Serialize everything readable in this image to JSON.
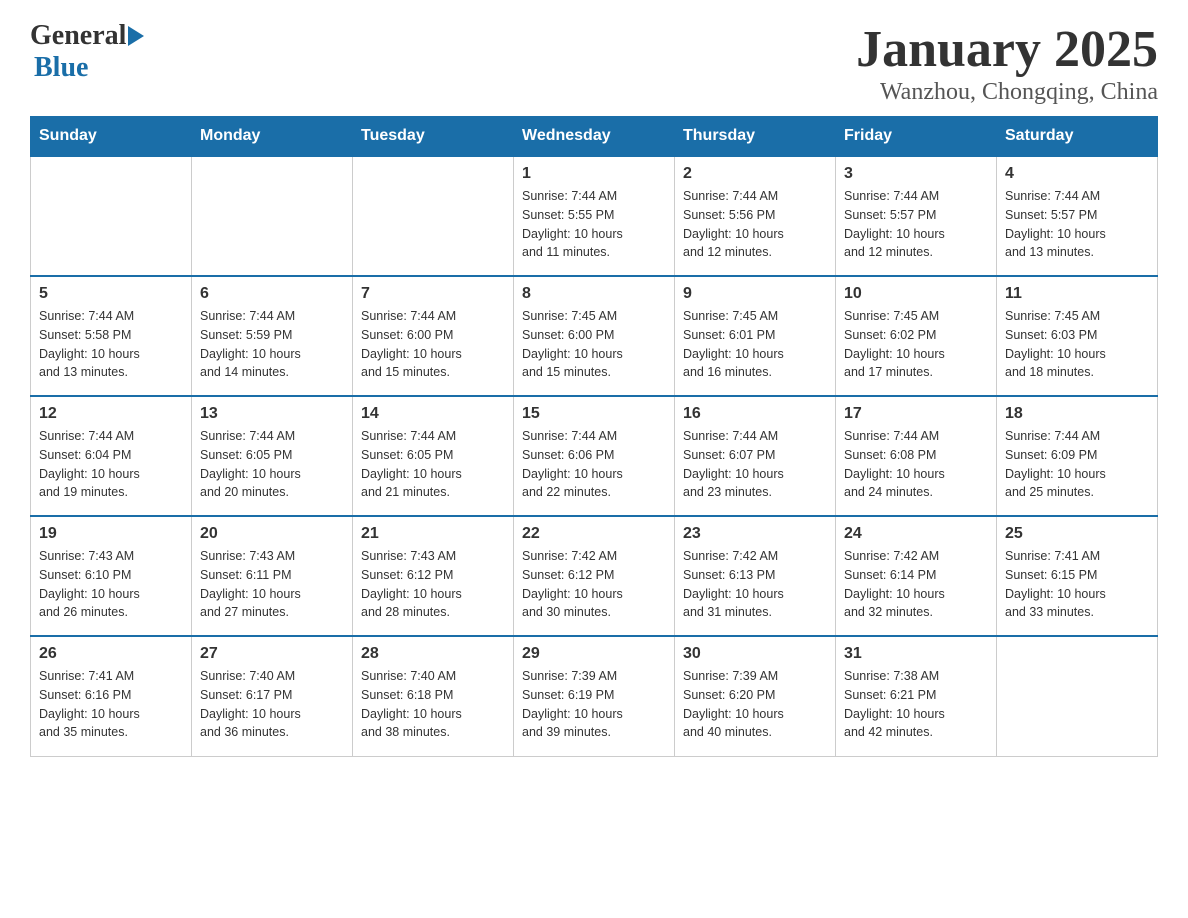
{
  "header": {
    "logo_general": "General",
    "logo_blue": "Blue",
    "main_title": "January 2025",
    "subtitle": "Wanzhou, Chongqing, China"
  },
  "days_of_week": [
    "Sunday",
    "Monday",
    "Tuesday",
    "Wednesday",
    "Thursday",
    "Friday",
    "Saturday"
  ],
  "weeks": [
    [
      {
        "day": "",
        "info": ""
      },
      {
        "day": "",
        "info": ""
      },
      {
        "day": "",
        "info": ""
      },
      {
        "day": "1",
        "info": "Sunrise: 7:44 AM\nSunset: 5:55 PM\nDaylight: 10 hours\nand 11 minutes."
      },
      {
        "day": "2",
        "info": "Sunrise: 7:44 AM\nSunset: 5:56 PM\nDaylight: 10 hours\nand 12 minutes."
      },
      {
        "day": "3",
        "info": "Sunrise: 7:44 AM\nSunset: 5:57 PM\nDaylight: 10 hours\nand 12 minutes."
      },
      {
        "day": "4",
        "info": "Sunrise: 7:44 AM\nSunset: 5:57 PM\nDaylight: 10 hours\nand 13 minutes."
      }
    ],
    [
      {
        "day": "5",
        "info": "Sunrise: 7:44 AM\nSunset: 5:58 PM\nDaylight: 10 hours\nand 13 minutes."
      },
      {
        "day": "6",
        "info": "Sunrise: 7:44 AM\nSunset: 5:59 PM\nDaylight: 10 hours\nand 14 minutes."
      },
      {
        "day": "7",
        "info": "Sunrise: 7:44 AM\nSunset: 6:00 PM\nDaylight: 10 hours\nand 15 minutes."
      },
      {
        "day": "8",
        "info": "Sunrise: 7:45 AM\nSunset: 6:00 PM\nDaylight: 10 hours\nand 15 minutes."
      },
      {
        "day": "9",
        "info": "Sunrise: 7:45 AM\nSunset: 6:01 PM\nDaylight: 10 hours\nand 16 minutes."
      },
      {
        "day": "10",
        "info": "Sunrise: 7:45 AM\nSunset: 6:02 PM\nDaylight: 10 hours\nand 17 minutes."
      },
      {
        "day": "11",
        "info": "Sunrise: 7:45 AM\nSunset: 6:03 PM\nDaylight: 10 hours\nand 18 minutes."
      }
    ],
    [
      {
        "day": "12",
        "info": "Sunrise: 7:44 AM\nSunset: 6:04 PM\nDaylight: 10 hours\nand 19 minutes."
      },
      {
        "day": "13",
        "info": "Sunrise: 7:44 AM\nSunset: 6:05 PM\nDaylight: 10 hours\nand 20 minutes."
      },
      {
        "day": "14",
        "info": "Sunrise: 7:44 AM\nSunset: 6:05 PM\nDaylight: 10 hours\nand 21 minutes."
      },
      {
        "day": "15",
        "info": "Sunrise: 7:44 AM\nSunset: 6:06 PM\nDaylight: 10 hours\nand 22 minutes."
      },
      {
        "day": "16",
        "info": "Sunrise: 7:44 AM\nSunset: 6:07 PM\nDaylight: 10 hours\nand 23 minutes."
      },
      {
        "day": "17",
        "info": "Sunrise: 7:44 AM\nSunset: 6:08 PM\nDaylight: 10 hours\nand 24 minutes."
      },
      {
        "day": "18",
        "info": "Sunrise: 7:44 AM\nSunset: 6:09 PM\nDaylight: 10 hours\nand 25 minutes."
      }
    ],
    [
      {
        "day": "19",
        "info": "Sunrise: 7:43 AM\nSunset: 6:10 PM\nDaylight: 10 hours\nand 26 minutes."
      },
      {
        "day": "20",
        "info": "Sunrise: 7:43 AM\nSunset: 6:11 PM\nDaylight: 10 hours\nand 27 minutes."
      },
      {
        "day": "21",
        "info": "Sunrise: 7:43 AM\nSunset: 6:12 PM\nDaylight: 10 hours\nand 28 minutes."
      },
      {
        "day": "22",
        "info": "Sunrise: 7:42 AM\nSunset: 6:12 PM\nDaylight: 10 hours\nand 30 minutes."
      },
      {
        "day": "23",
        "info": "Sunrise: 7:42 AM\nSunset: 6:13 PM\nDaylight: 10 hours\nand 31 minutes."
      },
      {
        "day": "24",
        "info": "Sunrise: 7:42 AM\nSunset: 6:14 PM\nDaylight: 10 hours\nand 32 minutes."
      },
      {
        "day": "25",
        "info": "Sunrise: 7:41 AM\nSunset: 6:15 PM\nDaylight: 10 hours\nand 33 minutes."
      }
    ],
    [
      {
        "day": "26",
        "info": "Sunrise: 7:41 AM\nSunset: 6:16 PM\nDaylight: 10 hours\nand 35 minutes."
      },
      {
        "day": "27",
        "info": "Sunrise: 7:40 AM\nSunset: 6:17 PM\nDaylight: 10 hours\nand 36 minutes."
      },
      {
        "day": "28",
        "info": "Sunrise: 7:40 AM\nSunset: 6:18 PM\nDaylight: 10 hours\nand 38 minutes."
      },
      {
        "day": "29",
        "info": "Sunrise: 7:39 AM\nSunset: 6:19 PM\nDaylight: 10 hours\nand 39 minutes."
      },
      {
        "day": "30",
        "info": "Sunrise: 7:39 AM\nSunset: 6:20 PM\nDaylight: 10 hours\nand 40 minutes."
      },
      {
        "day": "31",
        "info": "Sunrise: 7:38 AM\nSunset: 6:21 PM\nDaylight: 10 hours\nand 42 minutes."
      },
      {
        "day": "",
        "info": ""
      }
    ]
  ]
}
